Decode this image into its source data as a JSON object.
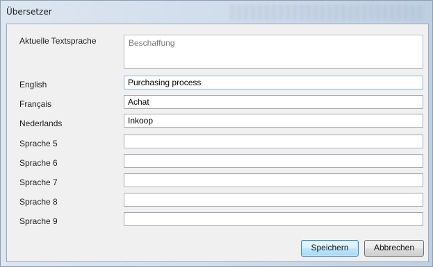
{
  "window": {
    "title": "Übersetzer"
  },
  "current": {
    "label": "Aktuelle Textsprache",
    "value": "Beschaffung"
  },
  "languages": [
    {
      "label": "English",
      "value": "Purchasing process"
    },
    {
      "label": "Français",
      "value": "Achat"
    },
    {
      "label": "Nederlands",
      "value": "Inkoop"
    },
    {
      "label": "Sprache 5",
      "value": ""
    },
    {
      "label": "Sprache 6",
      "value": ""
    },
    {
      "label": "Sprache 7",
      "value": ""
    },
    {
      "label": "Sprache 8",
      "value": ""
    },
    {
      "label": "Sprache 9",
      "value": ""
    }
  ],
  "buttons": {
    "save": "Speichern",
    "cancel": "Abbrechen"
  },
  "colors": {
    "focus_border": "#7eb4ea",
    "default_button_border": "#3c7fb1"
  }
}
